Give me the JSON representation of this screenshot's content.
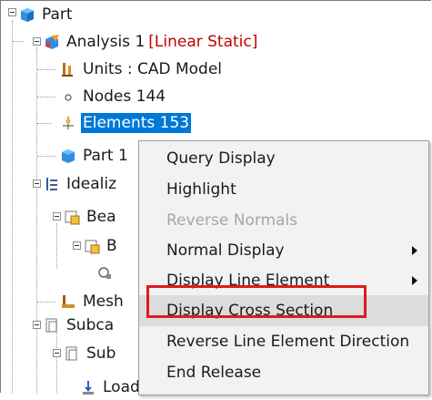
{
  "tree": {
    "part_label": "Part",
    "analysis_label": "Analysis 1",
    "analysis_type": "[Linear Static]",
    "units_label": "Units : CAD Model",
    "nodes_label": "Nodes 144",
    "elements_label": "Elements 153",
    "part1_label": "Part 1",
    "idealization_label": "Idealiz",
    "beam_label": "Bea",
    "beam_sub_label": "B",
    "mesh_label": "Mesh",
    "subcase_label": "Subca",
    "sub_label": "Sub",
    "loads_label": "Loads"
  },
  "context_menu": {
    "items": [
      {
        "label": "Query Display",
        "disabled": false,
        "submenu": false
      },
      {
        "label": "Highlight",
        "disabled": false,
        "submenu": false
      },
      {
        "label": "Reverse Normals",
        "disabled": true,
        "submenu": false
      },
      {
        "label": "Normal Display",
        "disabled": false,
        "submenu": true
      },
      {
        "label": "Display Line Element",
        "disabled": false,
        "submenu": true
      },
      {
        "label": "Display Cross Section",
        "disabled": false,
        "submenu": false
      },
      {
        "label": "Reverse Line Element Direction",
        "disabled": false,
        "submenu": false
      },
      {
        "label": "End Release",
        "disabled": false,
        "submenu": false
      }
    ]
  },
  "colors": {
    "selection": "#0078d7",
    "highlight_box": "#e01b1b",
    "analysis_type": "#c00000"
  }
}
